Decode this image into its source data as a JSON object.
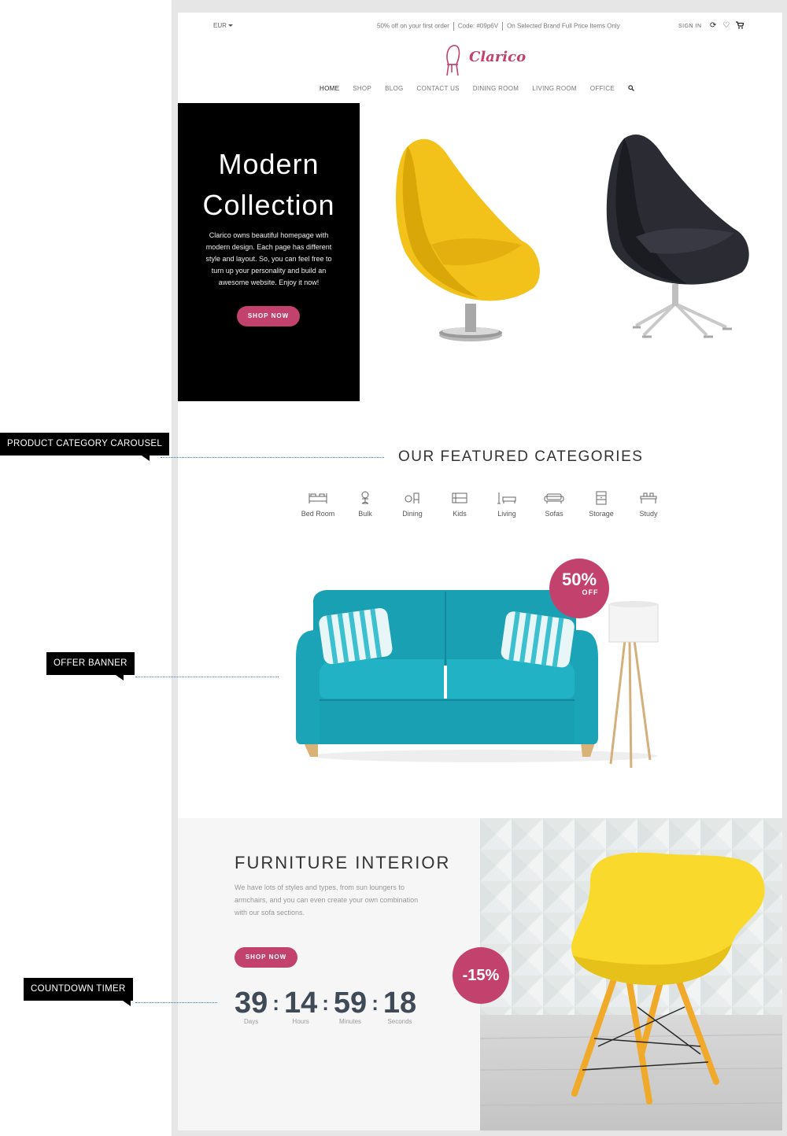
{
  "topbar": {
    "currency": "EUR",
    "promo_1": "50% off on your first order",
    "promo_2": "Code: #09p6V",
    "promo_3": "On Selected Brand Full Price Items Only",
    "signin": "SIGN IN",
    "icons": [
      "refresh-icon",
      "heart-icon",
      "cart-icon"
    ]
  },
  "brand": {
    "name": "Clarico",
    "color": "#c2426d"
  },
  "nav": {
    "items": [
      "HOME",
      "SHOP",
      "BLOG",
      "CONTACT US",
      "DINING ROOM",
      "LIVING ROOM",
      "OFFICE"
    ],
    "search_icon": "search-icon"
  },
  "hero": {
    "title_line1": "Modern",
    "title_line2": "Collection",
    "text": "Clarico owns beautiful homepage with modern design. Each page has different style and layout. So, you can feel free to turn up your personality and build an awesome website. Enjoy it now!",
    "button": "SHOP NOW"
  },
  "categories": {
    "title": "OUR FEATURED CATEGORIES",
    "items": [
      "Bed Room",
      "Bulk",
      "Dining",
      "Kids",
      "Living",
      "Sofas",
      "Storage",
      "Study"
    ]
  },
  "offer": {
    "badge_value": "50%",
    "badge_label": "OFF"
  },
  "interior": {
    "title": "FURNITURE INTERIOR",
    "text": "We have lots of styles and types, from sun loungers to armchairs, and you can even create your own combination with our sofa sections.",
    "button": "SHOP NOW",
    "badge": "-15%",
    "countdown": {
      "days": "39",
      "hours": "14",
      "minutes": "59",
      "seconds": "18",
      "days_label": "Days",
      "hours_label": "Hours",
      "minutes_label": "Minutes",
      "seconds_label": "Seconds"
    }
  },
  "annotations": {
    "carousel": "PRODUCT CATEGORY CAROUSEL",
    "offer": "OFFER BANNER",
    "countdown": "COUNTDOWN TIMER"
  },
  "colors": {
    "accent": "#c2426d",
    "annotation_line": "#2e84c8",
    "countdown_text": "#3e4a57"
  }
}
